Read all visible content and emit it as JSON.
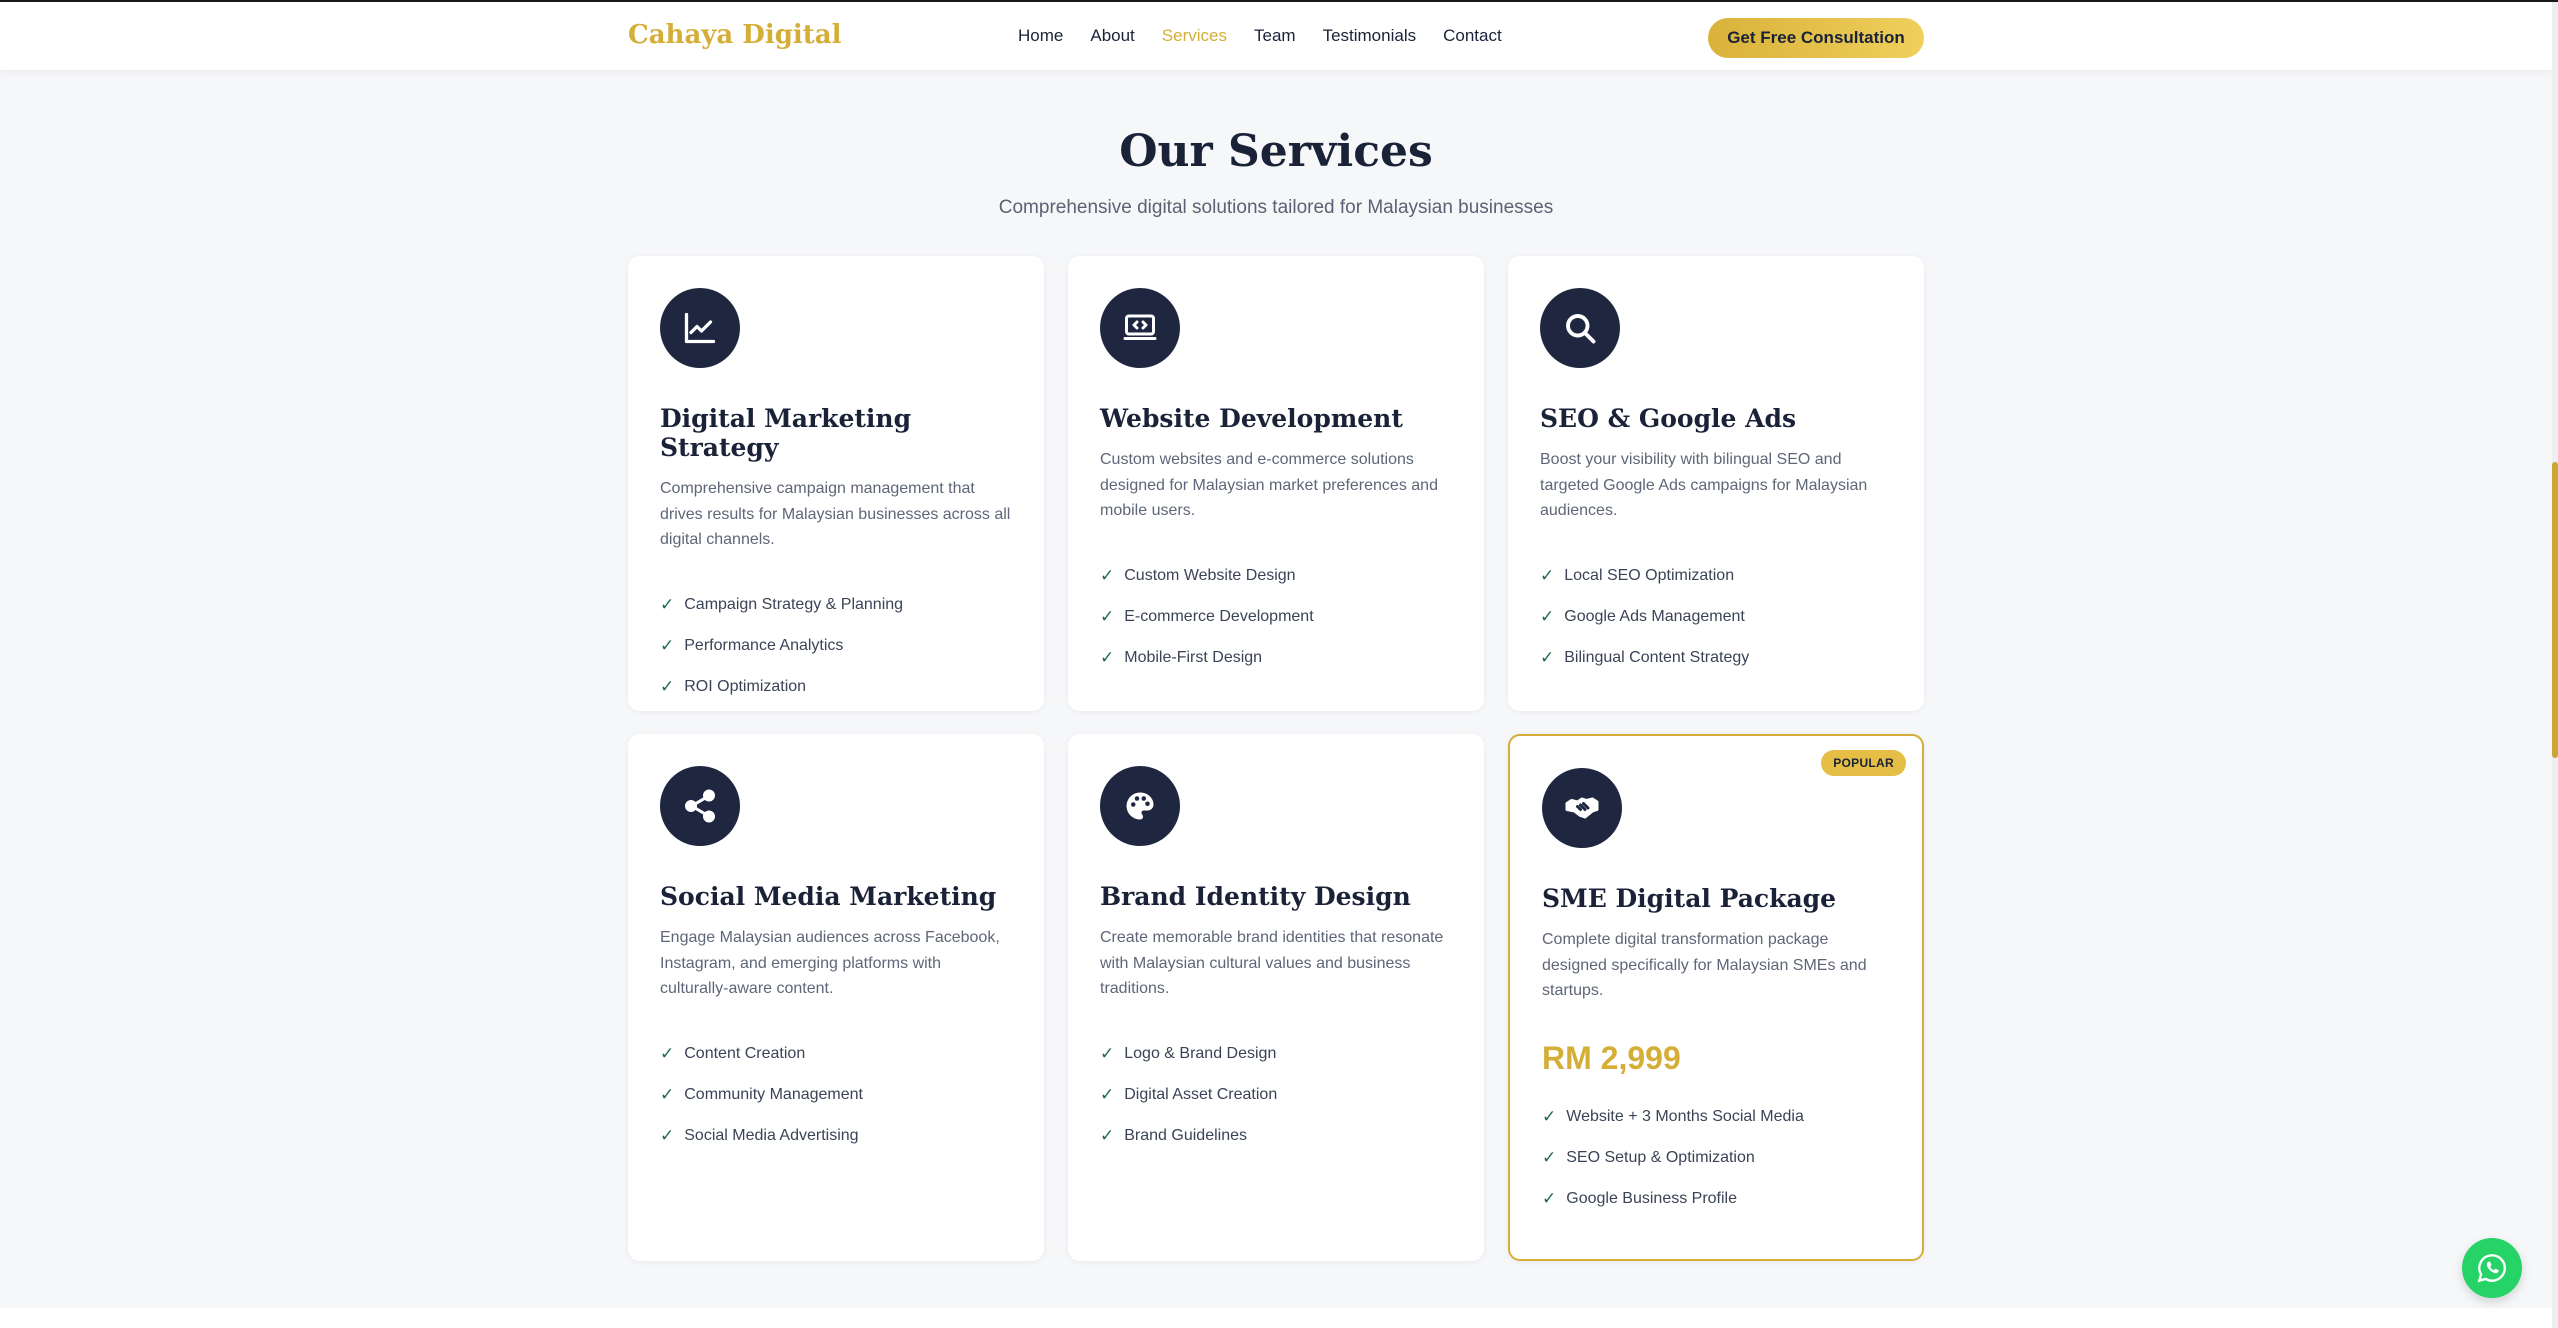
{
  "header": {
    "brand": "Cahaya Digital",
    "nav": [
      "Home",
      "About",
      "Services",
      "Team",
      "Testimonials",
      "Contact"
    ],
    "active_nav": "Services",
    "cta_label": "Get Free Consultation"
  },
  "section": {
    "title": "Our Services",
    "subtitle": "Comprehensive digital solutions tailored for Malaysian businesses"
  },
  "cards": [
    {
      "icon": "chart-icon",
      "title": "Digital Marketing Strategy",
      "description": "Comprehensive campaign management that drives results for Malaysian businesses across all digital channels.",
      "features": [
        "Campaign Strategy & Planning",
        "Performance Analytics",
        "ROI Optimization"
      ]
    },
    {
      "icon": "code-laptop-icon",
      "title": "Website Development",
      "description": "Custom websites and e-commerce solutions designed for Malaysian market preferences and mobile users.",
      "features": [
        "Custom Website Design",
        "E-commerce Development",
        "Mobile-First Design"
      ]
    },
    {
      "icon": "search-icon",
      "title": "SEO & Google Ads",
      "description": "Boost your visibility with bilingual SEO and targeted Google Ads campaigns for Malaysian audiences.",
      "features": [
        "Local SEO Optimization",
        "Google Ads Management",
        "Bilingual Content Strategy"
      ]
    },
    {
      "icon": "share-icon",
      "title": "Social Media Marketing",
      "description": "Engage Malaysian audiences across Facebook, Instagram, and emerging platforms with culturally-aware content.",
      "features": [
        "Content Creation",
        "Community Management",
        "Social Media Advertising"
      ]
    },
    {
      "icon": "palette-icon",
      "title": "Brand Identity Design",
      "description": "Create memorable brand identities that resonate with Malaysian cultural values and business traditions.",
      "features": [
        "Logo & Brand Design",
        "Digital Asset Creation",
        "Brand Guidelines"
      ]
    },
    {
      "icon": "handshake-icon",
      "title": "SME Digital Package",
      "badge": "POPULAR",
      "description": "Complete digital transformation package designed specifically for Malaysian SMEs and startups.",
      "price": "RM 2,999",
      "features": [
        "Website + 3 Months Social Media",
        "SEO Setup & Optimization",
        "Google Business Profile"
      ]
    }
  ],
  "colors": {
    "accent": "#d4ae37",
    "navy": "#1e2640",
    "check": "#1f6b46",
    "whatsapp": "#25d366"
  }
}
